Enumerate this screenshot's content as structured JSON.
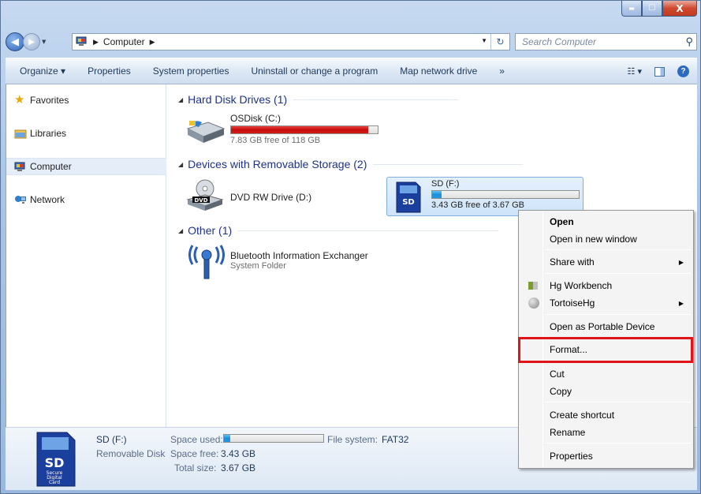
{
  "window": {
    "minimize_label": "▬",
    "maximize_label": "☐",
    "close_label": "X"
  },
  "address_bar": {
    "location": "Computer",
    "search_placeholder": "Search Computer"
  },
  "toolbar": {
    "organize": "Organize ▾",
    "properties": "Properties",
    "system_properties": "System properties",
    "uninstall": "Uninstall or change a program",
    "map_drive": "Map network drive",
    "more": "»"
  },
  "nav": {
    "favorites": "Favorites",
    "libraries": "Libraries",
    "computer": "Computer",
    "network": "Network"
  },
  "groups": {
    "hard_disks": "Hard Disk Drives (1)",
    "removable": "Devices with Removable Storage (2)",
    "other": "Other (1)"
  },
  "drives": {
    "os_disk": {
      "name": "OSDisk (C:)",
      "free": "7.83 GB free of 118 GB",
      "used_fraction": 0.934
    },
    "dvd": {
      "name": "DVD RW Drive (D:)",
      "icon_text": "DVD"
    },
    "sd": {
      "name": "SD (F:)",
      "free": "3.43 GB free of 3.67 GB",
      "used_fraction": 0.065,
      "icon_text": "SD"
    },
    "bluetooth": {
      "name": "Bluetooth Information Exchanger",
      "type": "System Folder"
    }
  },
  "details": {
    "name": "SD (F:)",
    "type": "Removable Disk",
    "space_used_label": "Space used:",
    "space_free_label": "Space free:",
    "space_free": "3.43 GB",
    "total_size_label": "Total size:",
    "total_size": "3.67 GB",
    "file_system_label": "File system:",
    "file_system": "FAT32",
    "used_fraction": 0.065,
    "card_title": "SD",
    "card_lines": [
      "Secure",
      "Digital",
      "Card"
    ]
  },
  "context_menu": {
    "open": "Open",
    "open_new_window": "Open in new window",
    "share_with": "Share with",
    "hg_workbench": "Hg Workbench",
    "tortoisehg": "TortoiseHg",
    "open_portable": "Open as Portable Device",
    "format": "Format...",
    "cut": "Cut",
    "copy": "Copy",
    "create_shortcut": "Create shortcut",
    "rename": "Rename",
    "properties": "Properties"
  },
  "colors": {
    "highlight_border": "#e0131b",
    "group_header": "#1e3287",
    "drive_bar_full": "#c80d0d",
    "drive_bar_normal": "#1b8ed8"
  }
}
